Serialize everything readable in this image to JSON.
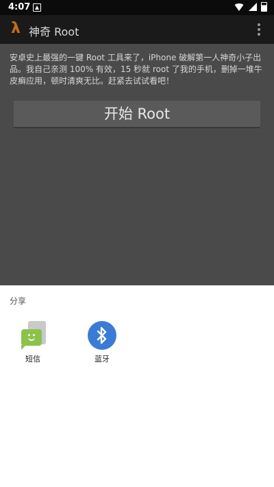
{
  "status_bar": {
    "time": "4:07"
  },
  "action_bar": {
    "title": "神奇 Root",
    "app_icon": "λ"
  },
  "content": {
    "description": "安卓史上最强的一键 Root 工具来了，iPhone 破解第一人神奇小子出品。我自己亲测 100% 有效，15 秒就 root 了我的手机，删掉一堆牛皮癣应用，顿时清爽无比。赶紧去试试看吧！",
    "start_button": "开始 Root"
  },
  "share_sheet": {
    "title": "分享",
    "targets": [
      {
        "label": "短信",
        "icon": "sms-icon"
      },
      {
        "label": "蓝牙",
        "icon": "bluetooth-icon"
      }
    ]
  },
  "colors": {
    "app_icon": "#c76b1a",
    "sms": "#8bc34a",
    "bluetooth": "#3a7bd5"
  }
}
